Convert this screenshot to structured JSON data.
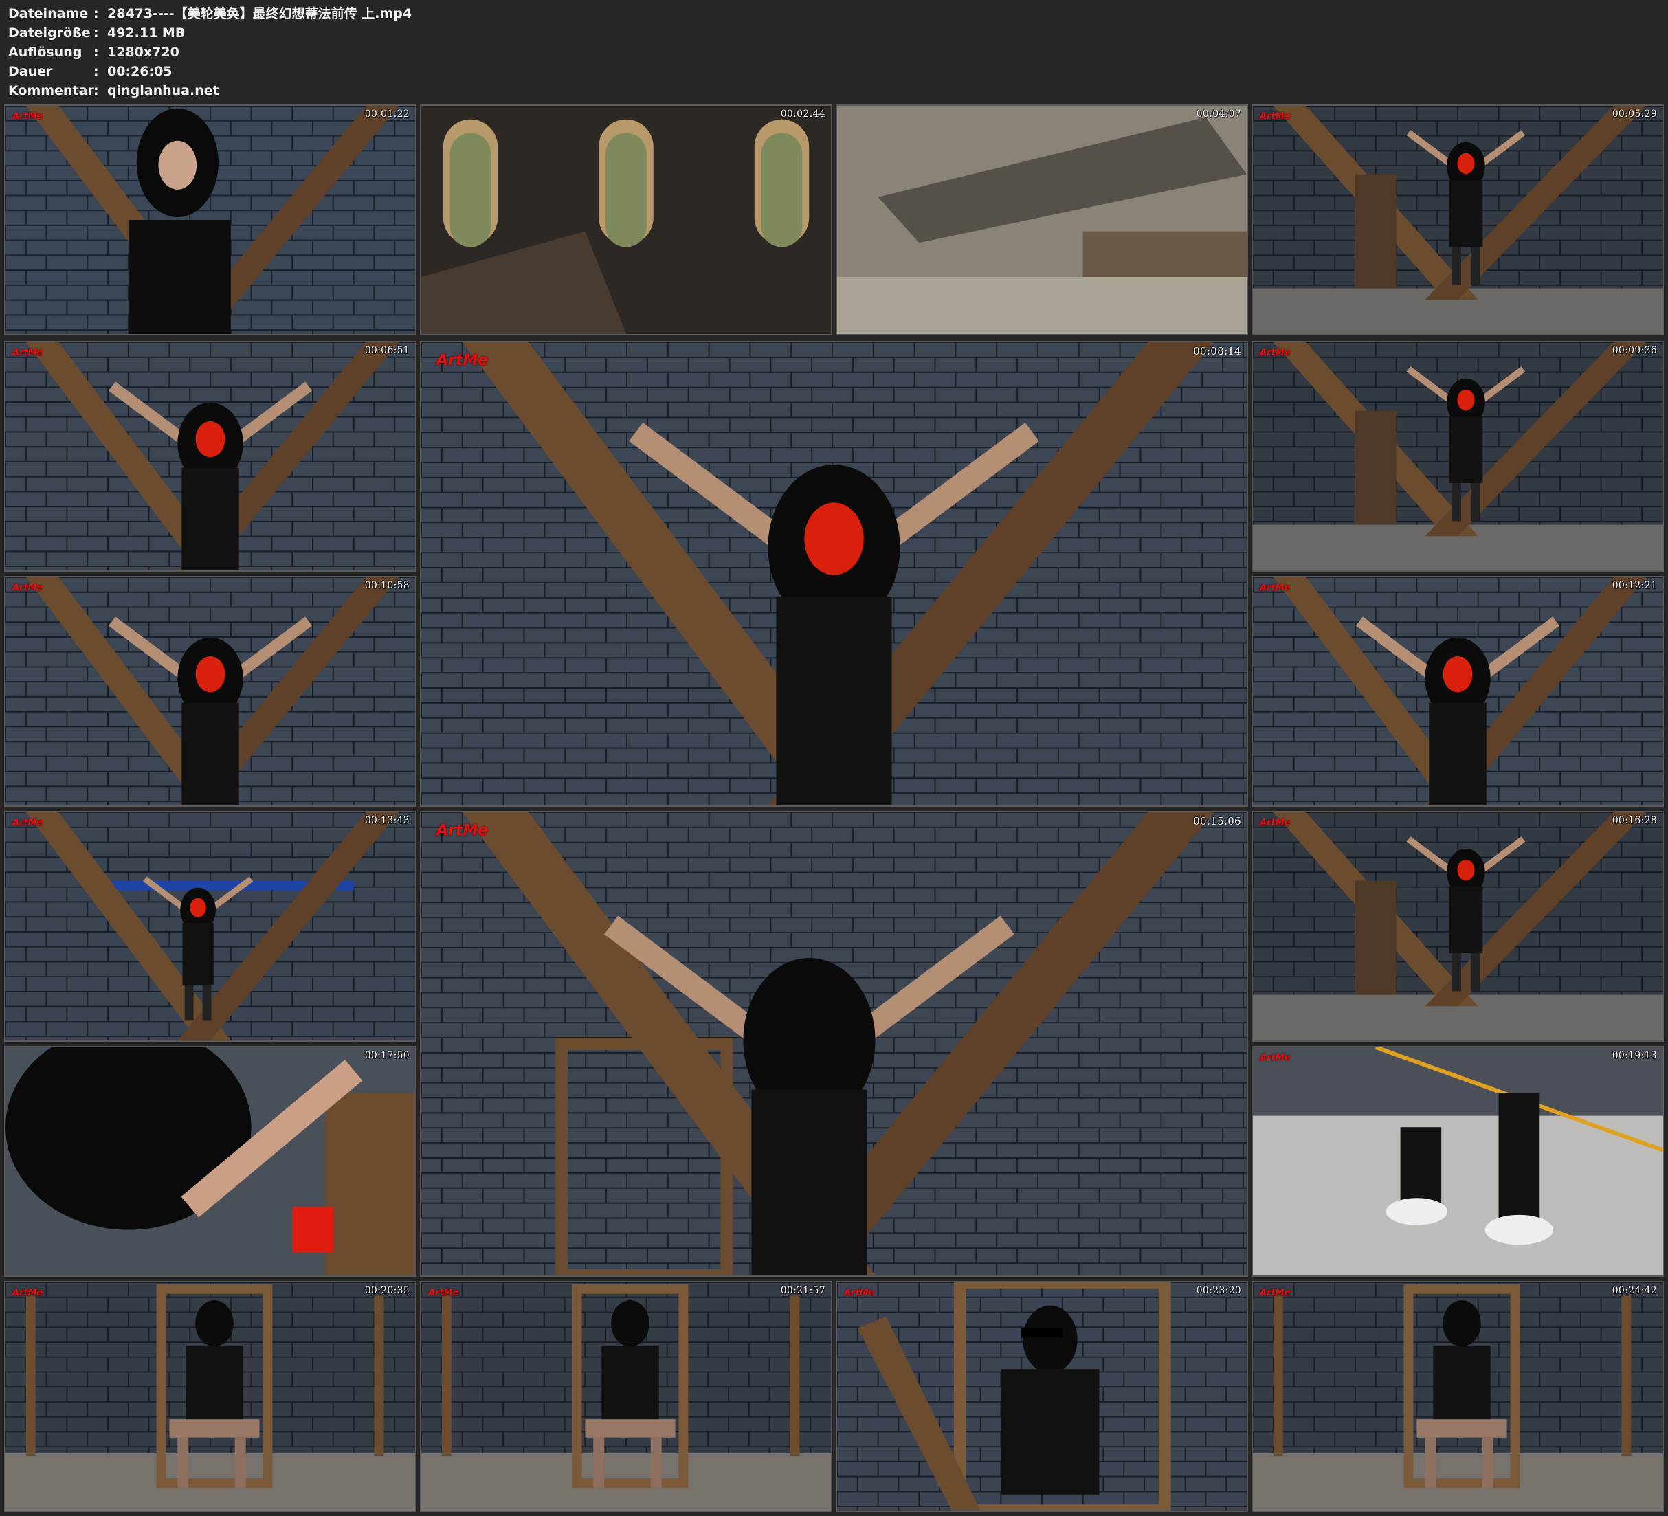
{
  "info": [
    {
      "key": "Dateiname",
      "value": "28473----【美轮美奂】最终幻想蒂法前传 上.mp4"
    },
    {
      "key": "Dateigröße",
      "value": "492.11 MB"
    },
    {
      "key": "Auflösung",
      "value": "1280x720"
    },
    {
      "key": "Dauer",
      "value": "00:26:05"
    },
    {
      "key": "Kommentar",
      "value": "qinglanhua.net"
    }
  ],
  "separator": ":",
  "frames": [
    {
      "time": "00:01:22",
      "scene": "portrait",
      "logo": "logo"
    },
    {
      "time": "00:02:44",
      "scene": "cathedral"
    },
    {
      "time": "00:04:07",
      "scene": "blur"
    },
    {
      "time": "00:05:29",
      "scene": "room-x",
      "logo": "logo"
    },
    {
      "time": "00:06:51",
      "scene": "close-arms",
      "logo": "logo"
    },
    {
      "time": "00:08:14",
      "scene": "close-arms",
      "logo": "logo"
    },
    {
      "time": "00:09:36",
      "scene": "room-x",
      "logo": "logo"
    },
    {
      "time": "00:10:58",
      "scene": "close-arms",
      "logo": "logo"
    },
    {
      "time": "00:12:21",
      "scene": "close-arms",
      "logo": "logo"
    },
    {
      "time": "00:13:43",
      "scene": "mid-x",
      "logo": "logo"
    },
    {
      "time": "00:15:06",
      "scene": "back-x",
      "logo": "logo"
    },
    {
      "time": "00:16:28",
      "scene": "room-x",
      "logo": "logo"
    },
    {
      "time": "00:17:50",
      "scene": "hair-close"
    },
    {
      "time": "00:19:13",
      "scene": "feet",
      "logo": "logo"
    },
    {
      "time": "00:20:35",
      "scene": "chair",
      "logo": "logo"
    },
    {
      "time": "00:21:57",
      "scene": "chair",
      "logo": "logo"
    },
    {
      "time": "00:23:20",
      "scene": "chair-close",
      "logo": "logo"
    },
    {
      "time": "00:24:42",
      "scene": "chair",
      "logo": "logo"
    }
  ],
  "logo_text": "ArtMe",
  "colors": {
    "background": "#262626",
    "text": "#f2f2f2",
    "logo": "#e01010"
  }
}
